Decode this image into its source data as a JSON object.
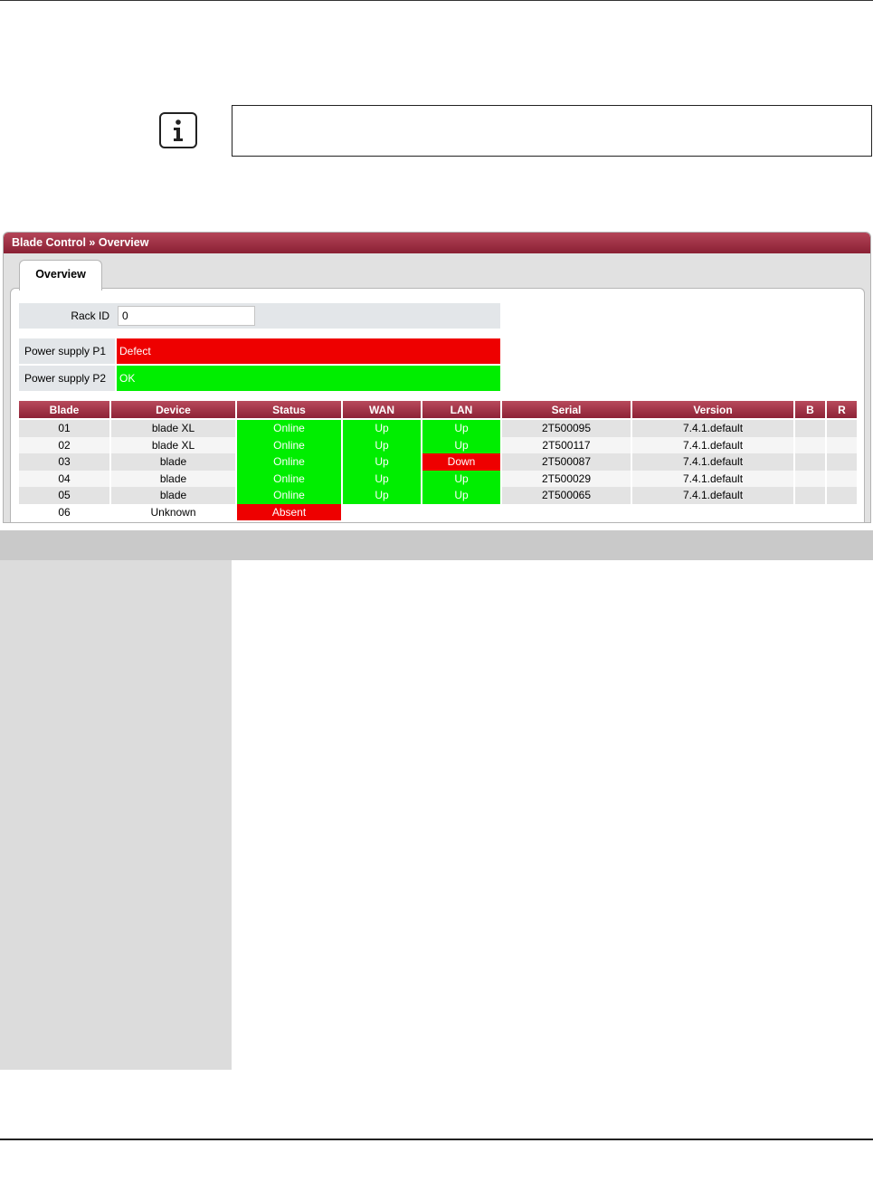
{
  "note": {
    "icon": "info-icon",
    "text": ""
  },
  "panel": {
    "title": "Blade Control » Overview",
    "tab_label": "Overview",
    "rack_id_label": "Rack ID",
    "rack_id_value": "0",
    "power_supplies": [
      {
        "label": "Power supply P1",
        "status": "Defect",
        "color": "#ee0000"
      },
      {
        "label": "Power supply P2",
        "status": "OK",
        "color": "#00ee00"
      }
    ],
    "table": {
      "headers": [
        "Blade",
        "Device",
        "Status",
        "WAN",
        "LAN",
        "Serial",
        "Version",
        "B",
        "R"
      ],
      "rows": [
        {
          "blade": "01",
          "device": "blade XL",
          "status": "Online",
          "wan": "Up",
          "lan": "Up",
          "serial": "2T500095",
          "version": "7.4.1.default"
        },
        {
          "blade": "02",
          "device": "blade XL",
          "status": "Online",
          "wan": "Up",
          "lan": "Up",
          "serial": "2T500117",
          "version": "7.4.1.default"
        },
        {
          "blade": "03",
          "device": "blade",
          "status": "Online",
          "wan": "Up",
          "lan": "Down",
          "serial": "2T500087",
          "version": "7.4.1.default"
        },
        {
          "blade": "04",
          "device": "blade",
          "status": "Online",
          "wan": "Up",
          "lan": "Up",
          "serial": "2T500029",
          "version": "7.4.1.default"
        },
        {
          "blade": "05",
          "device": "blade",
          "status": "Online",
          "wan": "Up",
          "lan": "Up",
          "serial": "2T500065",
          "version": "7.4.1.default"
        },
        {
          "blade": "06",
          "device": "Unknown",
          "status": "Absent",
          "wan": "",
          "lan": "",
          "serial": "",
          "version": ""
        }
      ]
    }
  },
  "colors": {
    "header_accent": "#8d2236",
    "ok_green": "#00ee00",
    "error_red": "#ee0000"
  }
}
